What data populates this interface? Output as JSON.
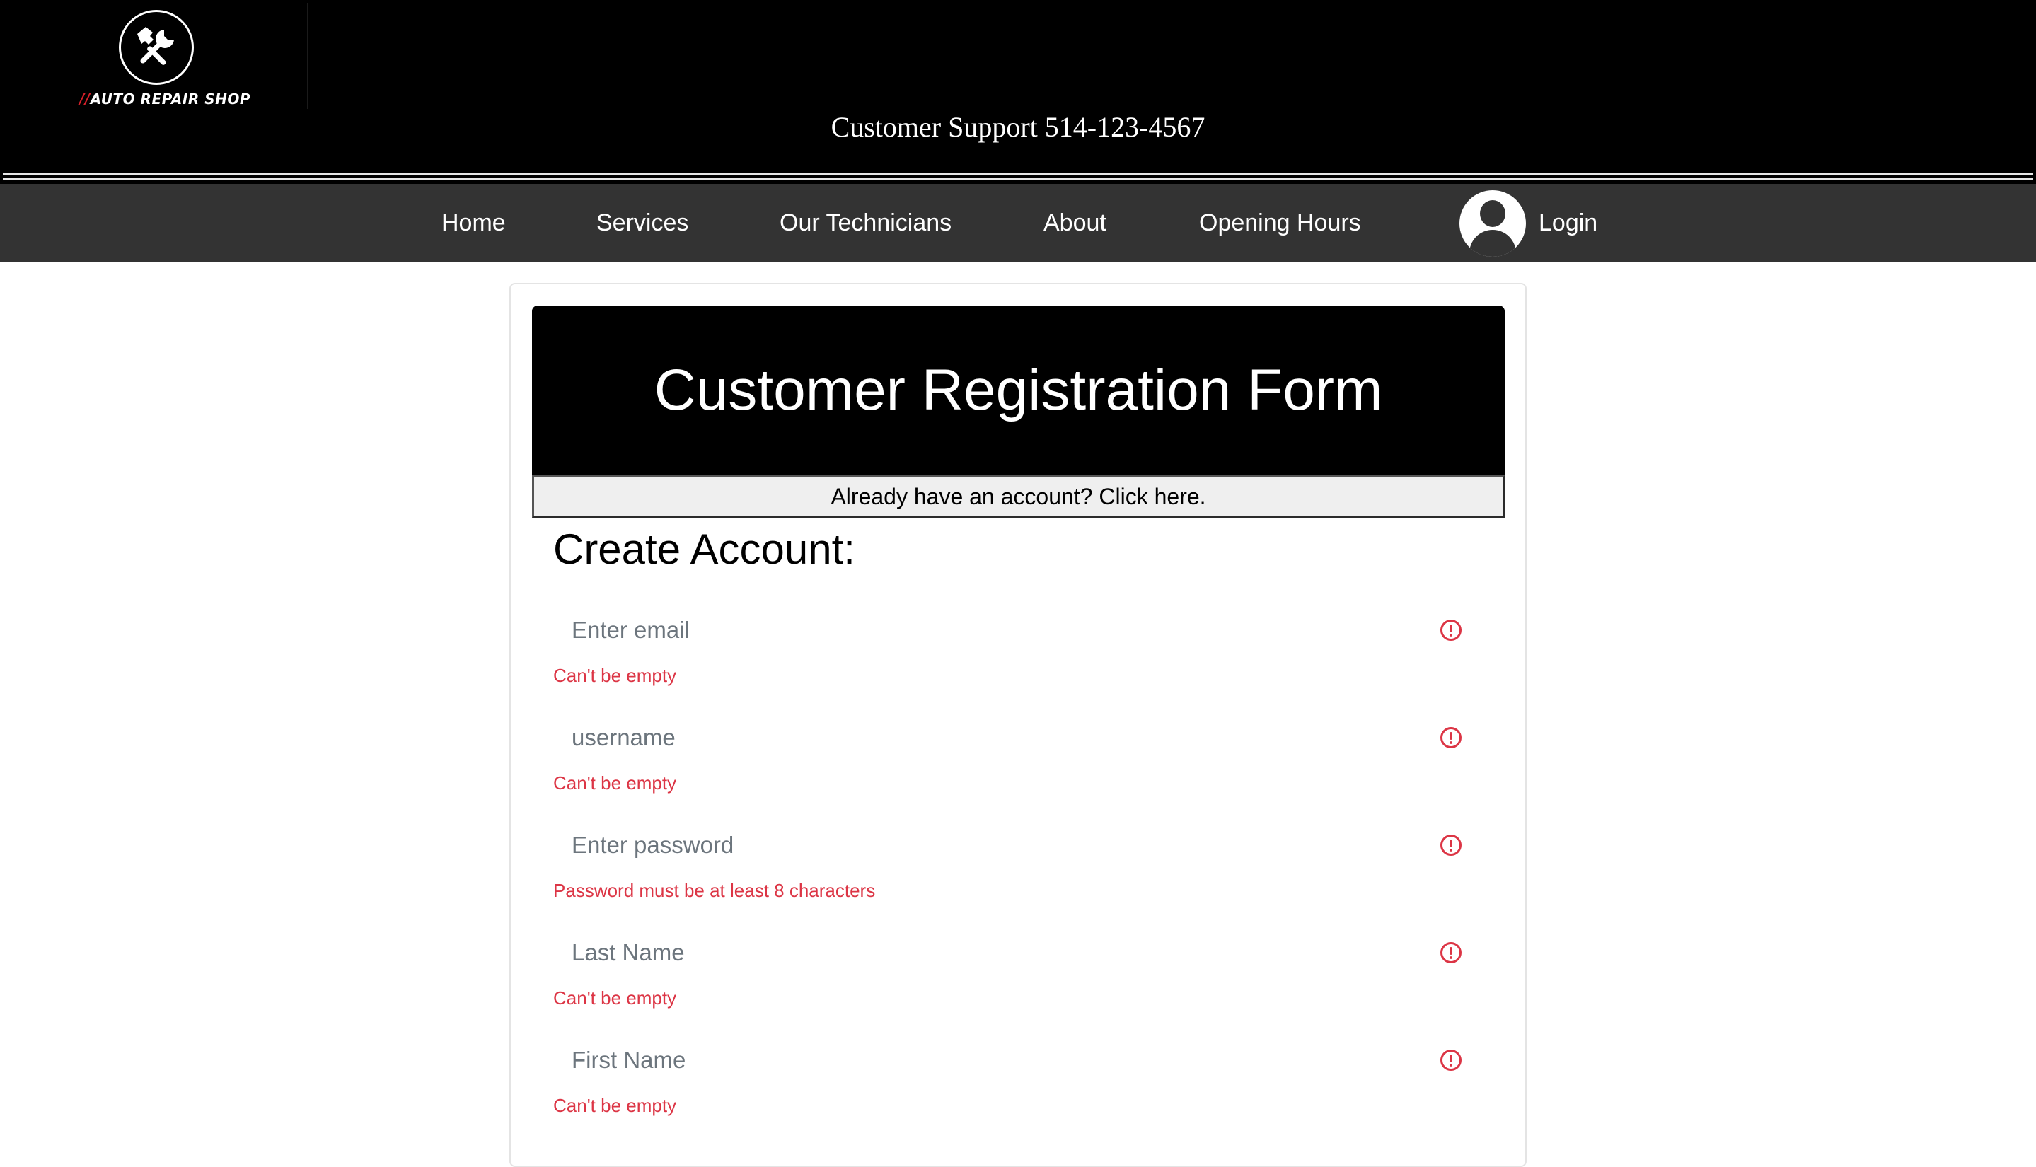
{
  "header": {
    "logo_slashes": "//",
    "logo_text": "AUTO REPAIR SHOP",
    "support": "Customer Support 514-123-4567"
  },
  "nav": {
    "items": [
      {
        "label": "Home"
      },
      {
        "label": "Services"
      },
      {
        "label": "Our Technicians"
      },
      {
        "label": "About"
      },
      {
        "label": "Opening Hours"
      }
    ],
    "login_label": "Login"
  },
  "form": {
    "title": "Customer Registration Form",
    "account_link": "Already have an account? Click here.",
    "subtitle": "Create Account:",
    "fields": [
      {
        "placeholder": "Enter email",
        "value": "",
        "error": "Can't be empty"
      },
      {
        "placeholder": "username",
        "value": "",
        "error": "Can't be empty"
      },
      {
        "placeholder": "Enter password",
        "value": "",
        "error": "Password must be at least 8 characters"
      },
      {
        "placeholder": "Last Name",
        "value": "",
        "error": "Can't be empty"
      },
      {
        "placeholder": "First Name",
        "value": "",
        "error": "Can't be empty"
      }
    ]
  },
  "colors": {
    "header_bg": "#000000",
    "nav_bg": "#333333",
    "error": "#dc3545",
    "logo_accent": "#d6202a"
  },
  "icons": {
    "logo": "hammer-wrench-icon",
    "user": "user-avatar-icon",
    "field_error": "exclamation-circle-icon"
  }
}
